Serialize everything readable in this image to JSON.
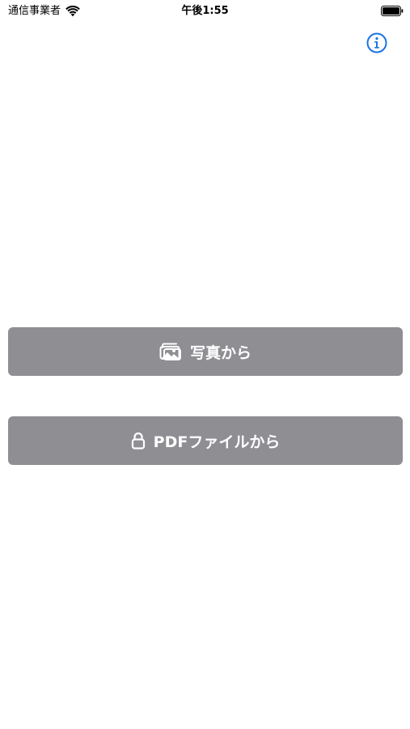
{
  "status_bar": {
    "carrier": "通信事業者",
    "time": "午後1:55"
  },
  "icons": {
    "wifi": "wifi-icon",
    "battery": "battery-icon",
    "info": "info-icon",
    "photos": "photos-icon",
    "lock": "lock-icon"
  },
  "colors": {
    "accent": "#1a73e8",
    "button_bg": "#8e8e93",
    "button_text": "#ffffff"
  },
  "actions": {
    "from_photos_label": "写真から",
    "from_pdf_label": "PDFファイルから"
  }
}
